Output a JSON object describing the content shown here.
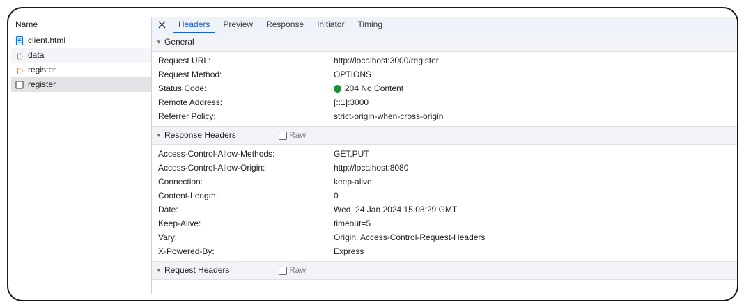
{
  "request_list": {
    "header": "Name",
    "items": [
      {
        "label": "client.html",
        "icon": "document-icon"
      },
      {
        "label": "data",
        "icon": "fetch-icon"
      },
      {
        "label": "register",
        "icon": "fetch-icon"
      },
      {
        "label": "register",
        "icon": "other-request-icon"
      }
    ]
  },
  "tabs": {
    "close_icon": "close-icon",
    "items": [
      "Headers",
      "Preview",
      "Response",
      "Initiator",
      "Timing"
    ],
    "active": "Headers"
  },
  "general": {
    "title": "General",
    "rows": [
      {
        "key": "Request URL:",
        "value": "http://localhost:3000/register"
      },
      {
        "key": "Request Method:",
        "value": "OPTIONS"
      },
      {
        "key": "Status Code:",
        "value": "204 No Content"
      },
      {
        "key": "Remote Address:",
        "value": "[::1]:3000"
      },
      {
        "key": "Referrer Policy:",
        "value": "strict-origin-when-cross-origin"
      }
    ]
  },
  "response_headers": {
    "title": "Response Headers",
    "raw_label": "Raw",
    "rows": [
      {
        "key": "Access-Control-Allow-Methods:",
        "value": "GET,PUT"
      },
      {
        "key": "Access-Control-Allow-Origin:",
        "value": "http://localhost:8080"
      },
      {
        "key": "Connection:",
        "value": "keep-alive"
      },
      {
        "key": "Content-Length:",
        "value": "0"
      },
      {
        "key": "Date:",
        "value": "Wed, 24 Jan 2024 15:03:29 GMT"
      },
      {
        "key": "Keep-Alive:",
        "value": "timeout=5"
      },
      {
        "key": "Vary:",
        "value": "Origin, Access-Control-Request-Headers"
      },
      {
        "key": "X-Powered-By:",
        "value": "Express"
      }
    ]
  },
  "request_headers": {
    "title": "Request Headers",
    "raw_label": "Raw"
  },
  "colors": {
    "accent": "#1a5fd0",
    "status_ok": "#1e8e3e",
    "fetch_icon": "#e8710a",
    "document_icon": "#1a73e8"
  }
}
